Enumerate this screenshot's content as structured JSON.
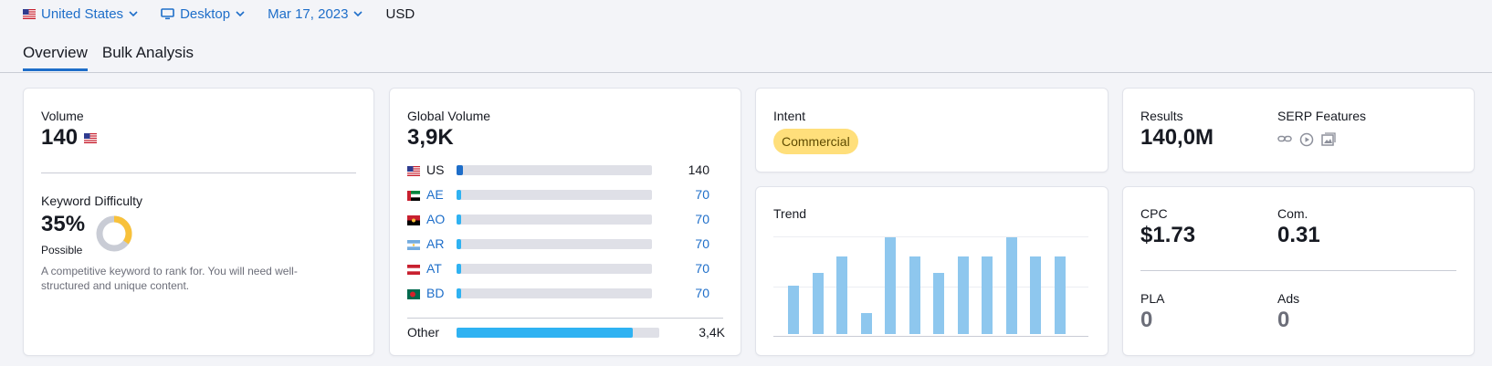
{
  "filters": {
    "country": "United States",
    "device": "Desktop",
    "date": "Mar 17, 2023",
    "currency": "USD"
  },
  "tabs": [
    {
      "label": "Overview",
      "active": true
    },
    {
      "label": "Bulk Analysis",
      "active": false
    }
  ],
  "volume": {
    "label": "Volume",
    "value": "140"
  },
  "keyword_difficulty": {
    "label": "Keyword Difficulty",
    "value": "35%",
    "level": "Possible",
    "percent": 35,
    "description": "A competitive keyword to rank for. You will need well-structured and unique content.",
    "color": "#f8c13a"
  },
  "global_volume": {
    "label": "Global Volume",
    "value": "3,9K",
    "rows": [
      {
        "code": "US",
        "value": "140",
        "fraction": 0.035,
        "is_link": false
      },
      {
        "code": "AE",
        "value": "70",
        "fraction": 0.017,
        "is_link": true
      },
      {
        "code": "AO",
        "value": "70",
        "fraction": 0.017,
        "is_link": true
      },
      {
        "code": "AR",
        "value": "70",
        "fraction": 0.017,
        "is_link": true
      },
      {
        "code": "AT",
        "value": "70",
        "fraction": 0.017,
        "is_link": true
      },
      {
        "code": "BD",
        "value": "70",
        "fraction": 0.017,
        "is_link": true
      }
    ],
    "other": {
      "label": "Other",
      "value": "3,4K",
      "fraction": 0.87
    }
  },
  "intent": {
    "label": "Intent",
    "value": "Commercial"
  },
  "results": {
    "label": "Results",
    "value": "140,0M",
    "serp_label": "SERP Features",
    "serp_icons": [
      "link-icon",
      "video-icon",
      "image-icon"
    ]
  },
  "trend": {
    "label": "Trend",
    "values": [
      0.5,
      0.63,
      0.8,
      0.22,
      1.0,
      0.8,
      0.63,
      0.8,
      0.8,
      1.0,
      0.8,
      0.8
    ]
  },
  "cpc": {
    "cpc_label": "CPC",
    "cpc_value": "$1.73",
    "com_label": "Com.",
    "com_value": "0.31",
    "pla_label": "PLA",
    "pla_value": "0",
    "ads_label": "Ads",
    "ads_value": "0"
  }
}
